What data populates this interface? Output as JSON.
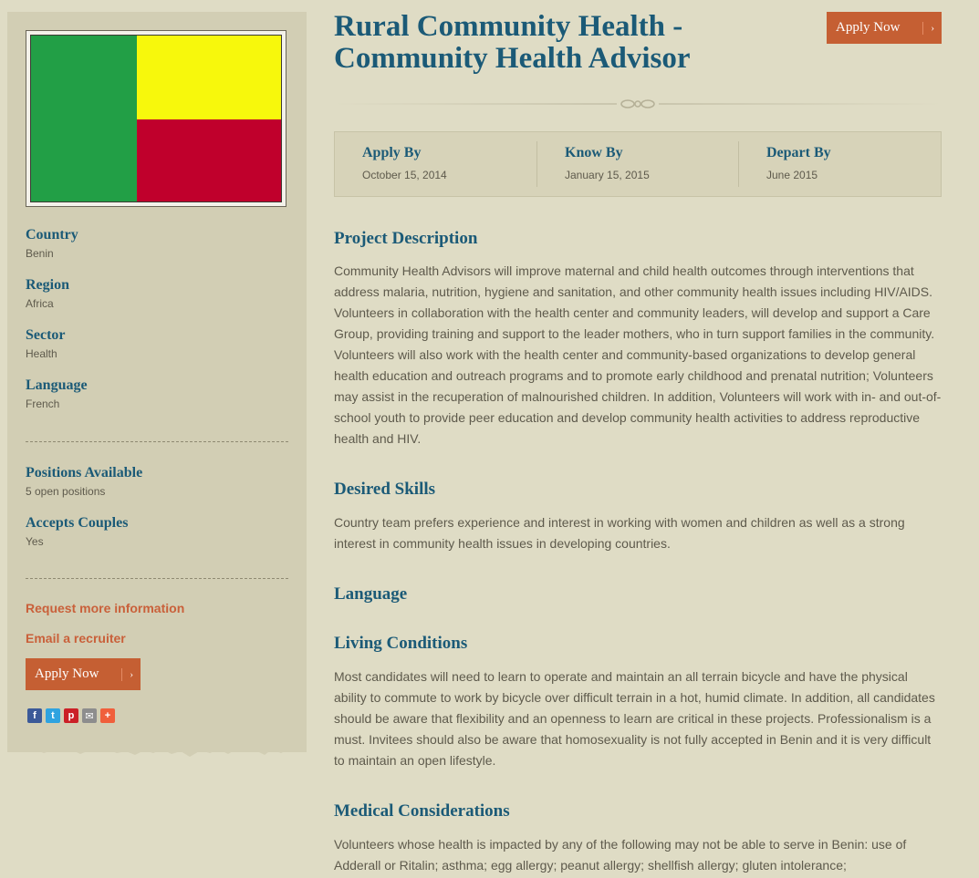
{
  "sidebar": {
    "flag_colors": {
      "left": "#229f46",
      "top_right": "#f7f80c",
      "bottom_right": "#c0002c"
    },
    "facts": [
      {
        "label": "Country",
        "value": "Benin"
      },
      {
        "label": "Region",
        "value": "Africa"
      },
      {
        "label": "Sector",
        "value": "Health"
      },
      {
        "label": "Language",
        "value": "French"
      }
    ],
    "positions": {
      "label": "Positions Available",
      "value": "5 open positions"
    },
    "couples": {
      "label": "Accepts Couples",
      "value": "Yes"
    },
    "request_info": "Request more information",
    "email_recruiter": "Email a recruiter",
    "apply_label": "Apply Now",
    "social_icons": [
      "facebook-icon",
      "twitter-icon",
      "pinterest-icon",
      "email-icon",
      "more-icon"
    ]
  },
  "header": {
    "title": "Rural Community Health - Community Health Advisor",
    "apply_label": "Apply Now"
  },
  "dates": [
    {
      "label": "Apply By",
      "value": "October 15, 2014"
    },
    {
      "label": "Know By",
      "value": "January 15, 2015"
    },
    {
      "label": "Depart By",
      "value": "June 2015"
    }
  ],
  "sections": {
    "project": {
      "title": "Project Description",
      "text": "Community Health Advisors will improve maternal and child health outcomes through interventions that address malaria, nutrition, hygiene and sanitation, and other community health issues including HIV/AIDS. Volunteers in collaboration with the health center and community leaders, will develop and support a Care Group, providing training and support to the leader mothers, who in turn support families in the community. Volunteers will also work with the health center and community-based organizations to develop general health education and outreach programs and to promote early childhood and prenatal nutrition; Volunteers may assist in the recuperation of malnourished children. In addition, Volunteers will work with in- and out-of-school youth to provide peer education and develop community health activities to address reproductive health and HIV."
    },
    "skills": {
      "title": "Desired Skills",
      "text": "Country team prefers experience and interest in working with women and children as well as a strong interest in community health issues in developing countries."
    },
    "language": {
      "title": "Language"
    },
    "living": {
      "title": "Living Conditions",
      "text": "Most candidates will need to learn to operate and maintain an all terrain bicycle and have the physical ability to commute to work by bicycle over difficult terrain in a hot, humid climate. In addition, all candidates should be aware that flexibility and an openness to learn are critical in these projects. Professionalism is a must. Invitees should also be aware that homosexuality is not fully accepted in Benin and it is very difficult to maintain an open lifestyle."
    },
    "medical": {
      "title": "Medical Considerations",
      "text": "Volunteers whose health is impacted by any of the following may not be able to serve in Benin: use of Adderall or Ritalin; asthma; egg allergy; peanut allergy; shellfish allergy; gluten intolerance;"
    }
  },
  "colors": {
    "accent": "#c55f33",
    "heading": "#1b5a77",
    "background": "#dfdcc5",
    "sidebar": "#d2ceb4"
  }
}
